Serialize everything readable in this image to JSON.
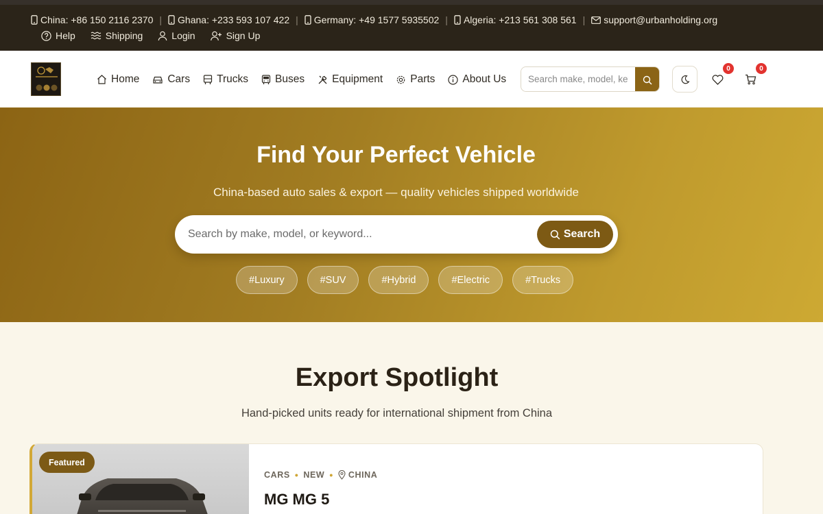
{
  "topbar": {
    "contacts": [
      {
        "label": "China: +86 150 2116 2370"
      },
      {
        "label": "Ghana: +233 593 107 422"
      },
      {
        "label": "Germany: +49 1577 5935502"
      },
      {
        "label": "Algeria: +213 561 308 561"
      }
    ],
    "email": "support@urbanholding.org",
    "links": {
      "help": "Help",
      "shipping": "Shipping",
      "login": "Login",
      "signup": "Sign Up"
    }
  },
  "nav": {
    "items": [
      {
        "label": "Home",
        "icon": "home-icon"
      },
      {
        "label": "Cars",
        "icon": "car-icon"
      },
      {
        "label": "Trucks",
        "icon": "truck-icon"
      },
      {
        "label": "Buses",
        "icon": "bus-icon"
      },
      {
        "label": "Equipment",
        "icon": "tools-icon"
      },
      {
        "label": "Parts",
        "icon": "gear-icon"
      },
      {
        "label": "About Us",
        "icon": "info-icon"
      }
    ],
    "search_placeholder": "Search make, model, keyword",
    "wishlist_count": "0",
    "cart_count": "0"
  },
  "hero": {
    "title": "Find Your Perfect Vehicle",
    "subtitle": "China-based auto sales & export — quality vehicles shipped worldwide",
    "search_placeholder": "Search by make, model, or keyword...",
    "search_button": "Search",
    "tags": [
      "#Luxury",
      "#SUV",
      "#Hybrid",
      "#Electric",
      "#Trucks"
    ]
  },
  "spotlight": {
    "title": "Export Spotlight",
    "subtitle": "Hand-picked units ready for international shipment from China",
    "card": {
      "badge": "Featured",
      "category": "CARS",
      "condition": "NEW",
      "location": "CHINA",
      "title": "MG MG 5"
    }
  },
  "colors": {
    "brand": "#8b6416",
    "dark": "#2b2419",
    "accent": "#d2a836",
    "badge": "#e2332f"
  }
}
